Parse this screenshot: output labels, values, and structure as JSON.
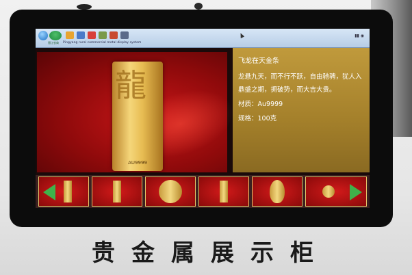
{
  "taskbar": {
    "app_logo_label": "银江农商",
    "app_title": "Pingyang rural commercial metal display system",
    "icons": [
      "windows-start-icon",
      "explorer-icon",
      "media-icon",
      "chrome-icon",
      "tool-icon",
      "app-icon",
      "window-icon"
    ]
  },
  "product": {
    "bar_stamp": "AU9999",
    "title": "飞龙在天金条",
    "description": "龙悬九天，而不行不跃，自由驰骋，犹人入鼎盛之期，拥破势，而大吉大贵。",
    "material": "材质：Au9999",
    "spec": "规格：100克"
  },
  "thumbnails": [
    "金条",
    "金条",
    "金币",
    "金条",
    "金葫芦",
    "金饰"
  ],
  "caption": "贵金属展示柜",
  "colors": {
    "accent_red": "#c81618",
    "gold": "#e7bc52",
    "nav_green": "#3fb24a"
  }
}
